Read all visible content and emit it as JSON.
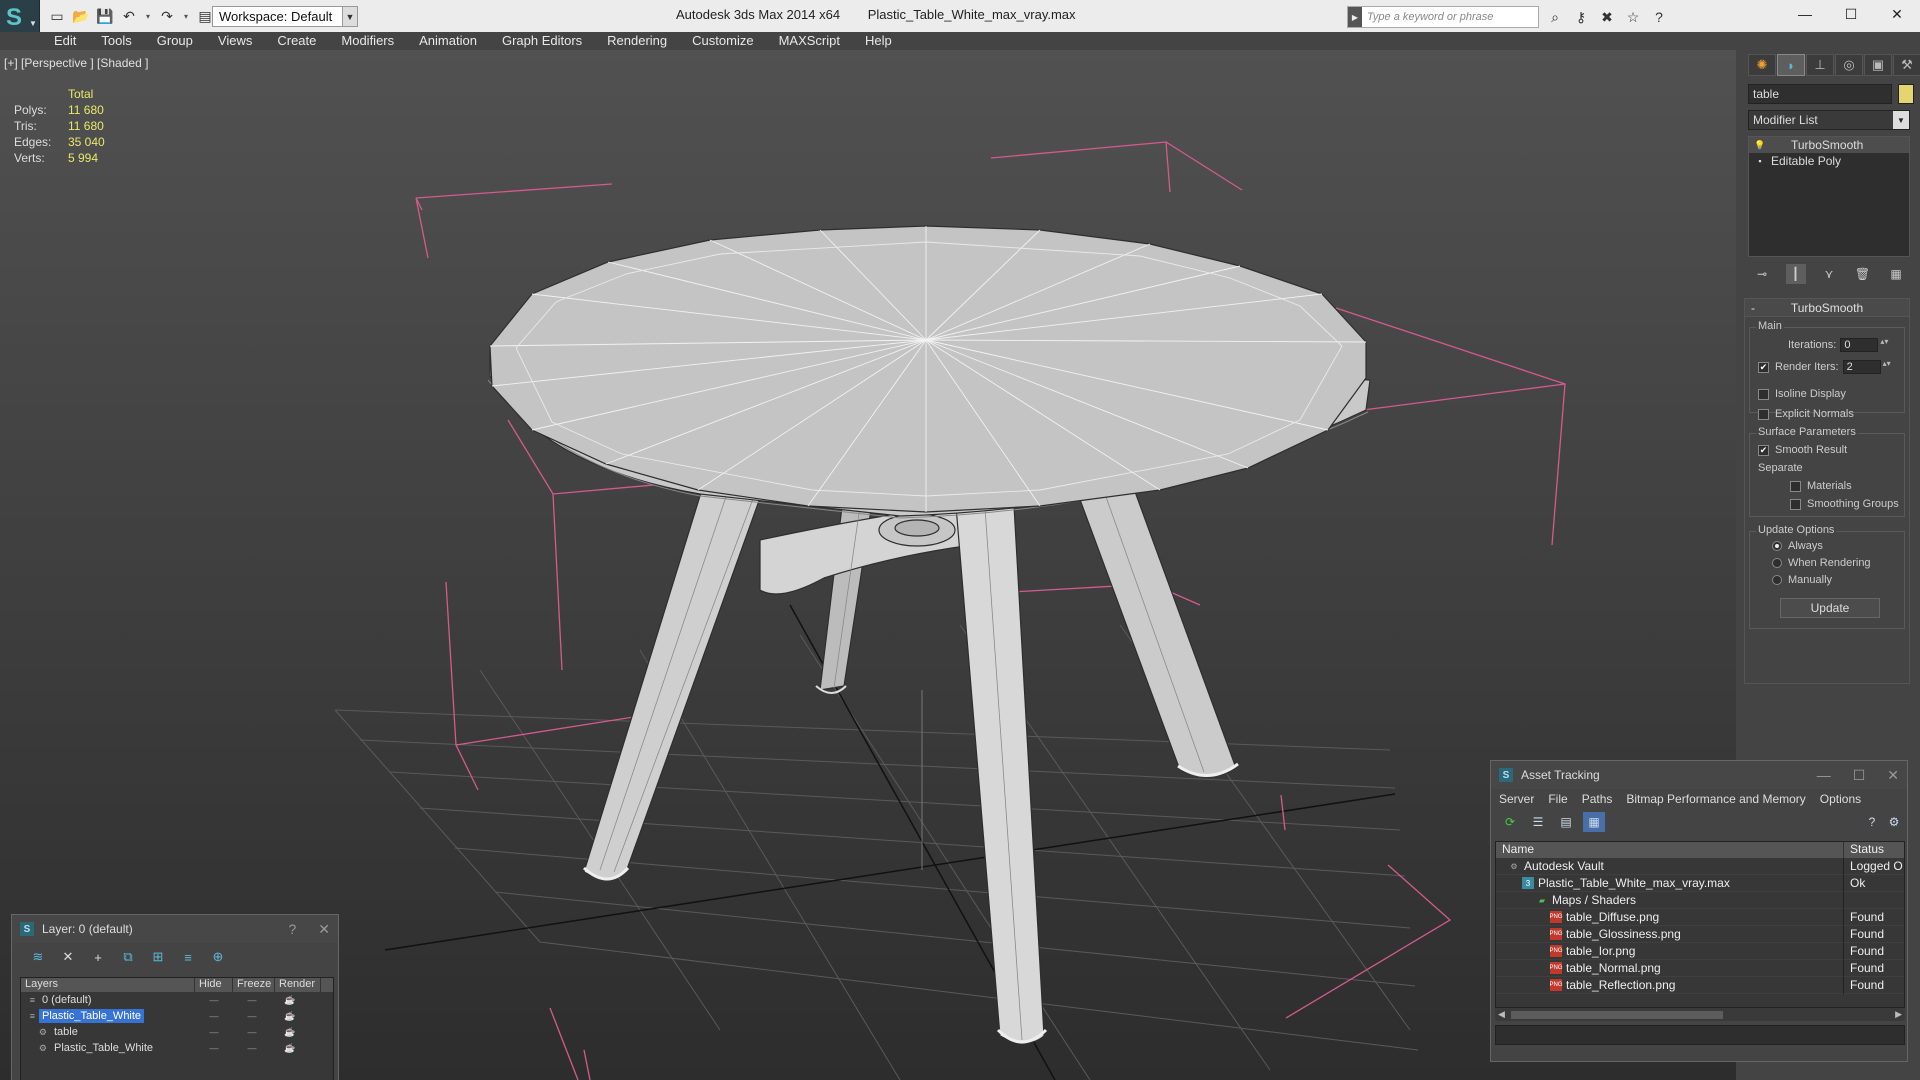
{
  "titlebar": {
    "workspace": "Workspace: Default",
    "app_title": "Autodesk 3ds Max  2014 x64",
    "file_name": "Plastic_Table_White_max_vray.max",
    "search_placeholder": "Type a keyword or phrase"
  },
  "menu": [
    "Edit",
    "Tools",
    "Group",
    "Views",
    "Create",
    "Modifiers",
    "Animation",
    "Graph Editors",
    "Rendering",
    "Customize",
    "MAXScript",
    "Help"
  ],
  "viewport": {
    "label": "[+] [Perspective ] [Shaded ]",
    "stats": {
      "header": "Total",
      "rows": [
        {
          "label": "Polys:",
          "value": "11 680"
        },
        {
          "label": "Tris:",
          "value": "11 680"
        },
        {
          "label": "Edges:",
          "value": "35 040"
        },
        {
          "label": "Verts:",
          "value": "5 994"
        }
      ]
    }
  },
  "command_panel": {
    "object_name": "table",
    "object_color": "#e4d56f",
    "modifier_list": "Modifier List",
    "stack": [
      "TurboSmooth",
      "Editable Poly"
    ],
    "rollout_title": "TurboSmooth",
    "main_group": "Main",
    "iterations_label": "Iterations:",
    "iterations_value": "0",
    "render_iters_label": "Render Iters:",
    "render_iters_value": "2",
    "render_iters_checked": true,
    "isoline_label": "Isoline Display",
    "isoline_checked": false,
    "explicit_normals_label": "Explicit Normals",
    "explicit_normals_checked": false,
    "surface_group": "Surface Parameters",
    "smooth_result_label": "Smooth Result",
    "smooth_result_checked": true,
    "separate_label": "Separate",
    "materials_label": "Materials",
    "materials_checked": false,
    "smoothing_groups_label": "Smoothing Groups",
    "smoothing_groups_checked": false,
    "update_group": "Update Options",
    "update_options": [
      "Always",
      "When Rendering",
      "Manually"
    ],
    "update_selected": "Always",
    "update_button": "Update"
  },
  "layer_window": {
    "title": "Layer: 0 (default)",
    "help": "?",
    "columns": [
      "Layers",
      "Hide",
      "Freeze",
      "Render"
    ],
    "rows": [
      {
        "name": "0 (default)",
        "indent": 1,
        "selected": false
      },
      {
        "name": "Plastic_Table_White",
        "indent": 1,
        "selected": true
      },
      {
        "name": "table",
        "indent": 2,
        "selected": false
      },
      {
        "name": "Plastic_Table_White",
        "indent": 2,
        "selected": false
      }
    ]
  },
  "asset_window": {
    "title": "Asset Tracking",
    "menu": [
      "Server",
      "File",
      "Paths",
      "Bitmap Performance and Memory",
      "Options"
    ],
    "columns": [
      "Name",
      "Status"
    ],
    "rows": [
      {
        "name": "Autodesk Vault",
        "status": "Logged O",
        "indent": 1,
        "icon": "vault"
      },
      {
        "name": "Plastic_Table_White_max_vray.max",
        "status": "Ok",
        "indent": 2,
        "icon": "max"
      },
      {
        "name": "Maps / Shaders",
        "status": "",
        "indent": 3,
        "icon": "folder"
      },
      {
        "name": "table_Diffuse.png",
        "status": "Found",
        "indent": 4,
        "icon": "png"
      },
      {
        "name": "table_Glossiness.png",
        "status": "Found",
        "indent": 4,
        "icon": "png"
      },
      {
        "name": "table_Ior.png",
        "status": "Found",
        "indent": 4,
        "icon": "png"
      },
      {
        "name": "table_Normal.png",
        "status": "Found",
        "indent": 4,
        "icon": "png"
      },
      {
        "name": "table_Reflection.png",
        "status": "Found",
        "indent": 4,
        "icon": "png"
      }
    ]
  }
}
